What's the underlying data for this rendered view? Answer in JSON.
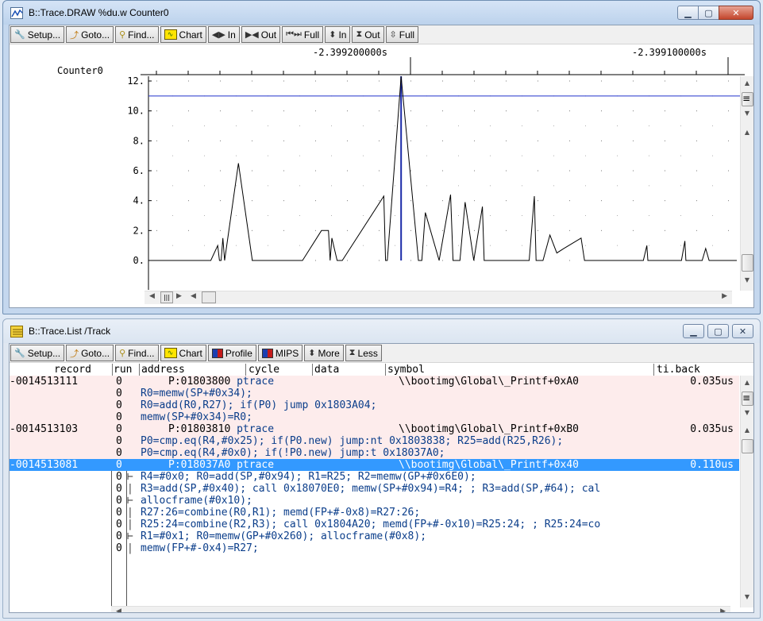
{
  "trace_window": {
    "title": "B::Trace.DRAW %du.w Counter0",
    "toolbar": [
      "Setup...",
      "Goto...",
      "Find...",
      "Chart",
      "In",
      "Out",
      "Full",
      "In",
      "Out",
      "Full"
    ],
    "time_labels": [
      "-2.399200000s",
      "-2.399100000s"
    ],
    "track_name": "Counter0",
    "y_ticks": [
      "12.",
      "10.",
      "8.",
      "6.",
      "4.",
      "2.",
      "0."
    ]
  },
  "chart_data": {
    "type": "line",
    "ylim": [
      0,
      12.5
    ],
    "threshold": 11.0,
    "x": [
      0,
      18,
      20,
      20.5,
      21,
      21.5,
      22,
      26,
      30,
      44,
      44.5,
      50,
      52,
      52.5,
      53,
      54.5,
      56,
      68,
      68.5,
      69,
      73,
      78,
      78.5,
      79,
      80,
      84,
      87.3,
      88,
      90,
      91.5,
      94,
      96.5,
      97,
      100,
      110,
      111.5,
      112,
      113.5,
      114,
      116,
      118,
      120,
      125,
      126,
      127,
      133,
      138,
      143,
      144,
      144.3,
      145,
      149,
      154,
      155,
      155.3,
      156,
      160,
      161,
      162,
      166,
      166.3,
      168,
      170
    ],
    "y": [
      0,
      0,
      1,
      0,
      0,
      1.5,
      0,
      6.5,
      0,
      0,
      0,
      2,
      2,
      0,
      1.5,
      0,
      0,
      4.3,
      0,
      0,
      12.3,
      0,
      0,
      0,
      3.2,
      0,
      4.4,
      0,
      0,
      3.9,
      0,
      3.6,
      0,
      0,
      0,
      4.3,
      0,
      0,
      0,
      1.7,
      0.5,
      0.8,
      1.5,
      0,
      0,
      0,
      0,
      0,
      1.0,
      0,
      0,
      0,
      0,
      1.3,
      0,
      0,
      0,
      0.8,
      0,
      0,
      0,
      0,
      0
    ]
  },
  "list_window": {
    "title": "B::Trace.List /Track",
    "toolbar": [
      "Setup...",
      "Goto...",
      "Find...",
      "Chart",
      "Profile",
      "MIPS",
      "More",
      "Less"
    ],
    "columns": [
      "record",
      "run",
      "address",
      "cycle",
      "data",
      "symbol",
      "ti.back"
    ],
    "rows": [
      {
        "kind": "rec",
        "rec": "-0014513111",
        "run": "0",
        "addr": "P:01803800",
        "cycle": "ptrace",
        "sym": "\\\\bootimg\\Global\\_Printf+0xA0",
        "tib": "0.035us"
      },
      {
        "kind": "code",
        "run": "0",
        "text": "R0=memw(SP+#0x34);"
      },
      {
        "kind": "code",
        "run": "0",
        "text": "R0=add(R0,R27); if(P0) jump 0x1803A04;",
        "dim": true
      },
      {
        "kind": "code",
        "run": "0",
        "text": "memw(SP+#0x34)=R0;"
      },
      {
        "kind": "rec",
        "rec": "-0014513103",
        "run": "0",
        "addr": "P:01803810",
        "cycle": "ptrace",
        "sym": "\\\\bootimg\\Global\\_Printf+0xB0",
        "tib": "0.035us"
      },
      {
        "kind": "code",
        "run": "0",
        "text": "P0=cmp.eq(R4,#0x25); if(P0.new) jump:nt 0x1803838; R25=add(R25,R26);",
        "dim": true
      },
      {
        "kind": "code",
        "run": "0",
        "text": "P0=cmp.eq(R4,#0x0); if(!P0.new) jump:t 0x18037A0;"
      },
      {
        "kind": "sel",
        "rec": "-0014513081",
        "run": "0",
        "addr": "P:018037A0",
        "cycle": "ptrace",
        "sym": "\\\\bootimg\\Global\\_Printf+0x40",
        "tib": "0.110us"
      },
      {
        "kind": "code",
        "run": "0",
        "tick": "⊢",
        "text": "R4=#0x0; R0=add(SP,#0x94); R1=R25; R2=memw(GP+#0x6E0);"
      },
      {
        "kind": "code",
        "run": "0",
        "tick": "|",
        "text": "R3=add(SP,#0x40); call 0x18070E0; memw(SP+#0x94)=R4; ; R3=add(SP,#64); cal"
      },
      {
        "kind": "code",
        "run": "0",
        "tick": "⊢",
        "text": "allocframe(#0x10);"
      },
      {
        "kind": "code",
        "run": "0",
        "tick": "|",
        "text": "R27:26=combine(R0,R1); memd(FP+#-0x8)=R27:26;"
      },
      {
        "kind": "code",
        "run": "0",
        "tick": "|",
        "text": "R25:24=combine(R2,R3); call 0x1804A20; memd(FP+#-0x10)=R25:24; ; R25:24=co"
      },
      {
        "kind": "code",
        "run": "0",
        "tick": "⊢",
        "text": "R1=#0x1; R0=memw(GP+#0x260); allocframe(#0x8);"
      },
      {
        "kind": "code",
        "run": "0",
        "tick": "|",
        "text": "memw(FP+#-0x4)=R27;"
      }
    ]
  }
}
